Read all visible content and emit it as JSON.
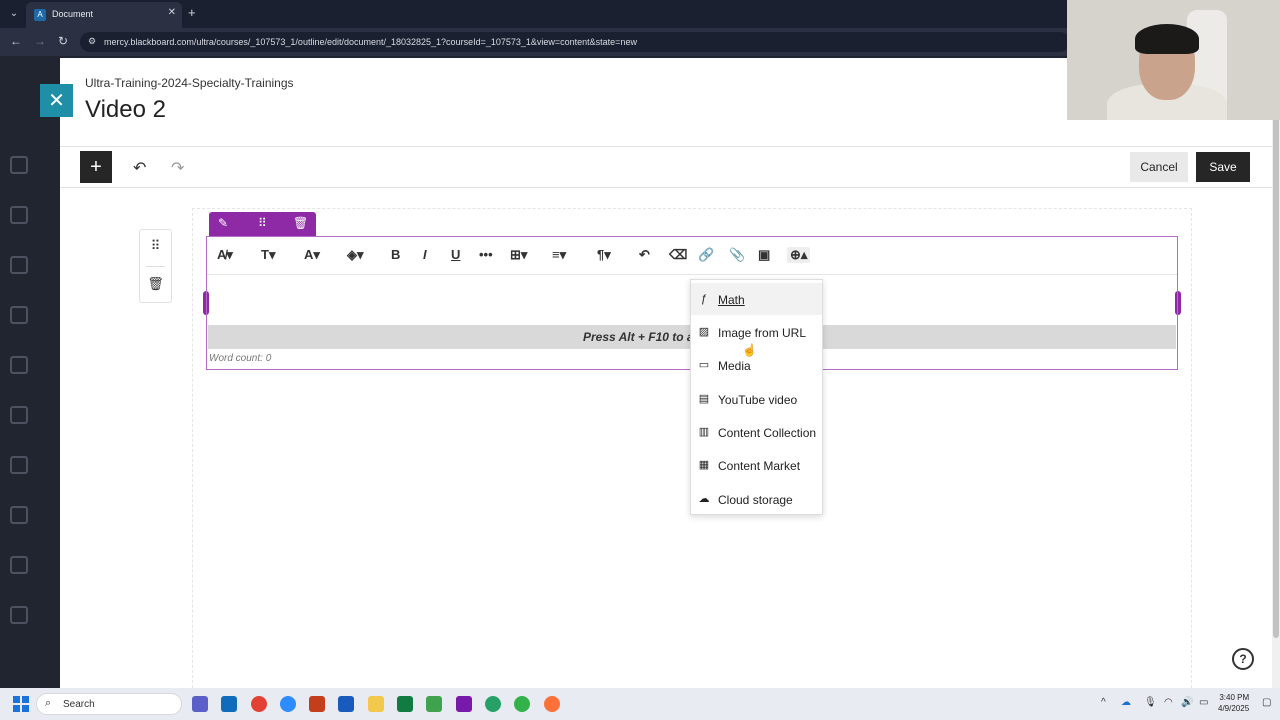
{
  "browser": {
    "tab_title": "Document",
    "url": "mercy.blackboard.com/ultra/courses/_107573_1/outline/edit/document/_18032825_1?courseId=_107573_1&view=content&state=new"
  },
  "page": {
    "course_name": "Ultra-Training-2024-Specialty-Trainings",
    "title": "Video 2"
  },
  "actions": {
    "cancel_label": "Cancel",
    "save_label": "Save"
  },
  "editor": {
    "hint": "Press Alt + F10 to ac",
    "word_count": "Word count: 0"
  },
  "insert_menu": {
    "items": [
      {
        "label": "Math",
        "icon": "math-icon"
      },
      {
        "label": "Image from URL",
        "icon": "image-url-icon"
      },
      {
        "label": "Media",
        "icon": "media-icon"
      },
      {
        "label": "YouTube video",
        "icon": "youtube-icon"
      },
      {
        "label": "Content Collection",
        "icon": "content-collection-icon"
      },
      {
        "label": "Content Market",
        "icon": "content-market-icon"
      },
      {
        "label": "Cloud storage",
        "icon": "cloud-storage-icon"
      }
    ]
  },
  "taskbar": {
    "search_label": "Search",
    "time": "3:40 PM",
    "date": "4/9/2025"
  },
  "colors": {
    "accent_purple": "#8f2aa6",
    "close_teal": "#1f8fa7",
    "dark_button": "#262626"
  }
}
